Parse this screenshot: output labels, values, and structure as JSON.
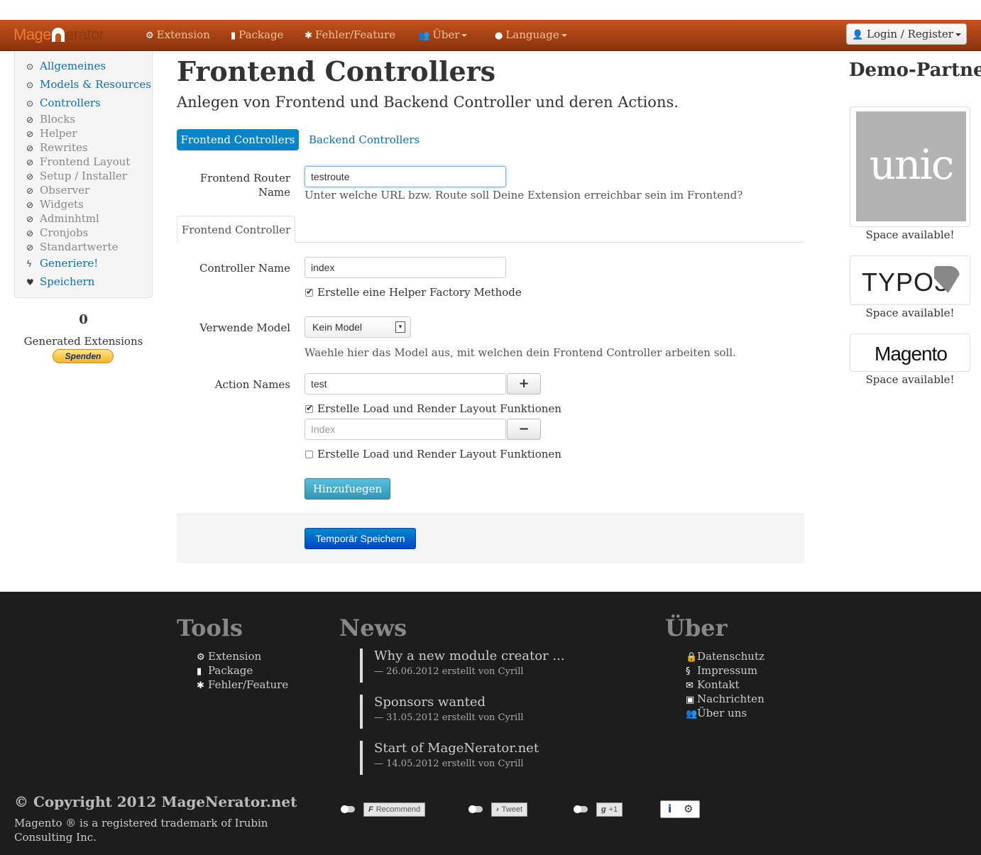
{
  "navbar": {
    "brand_start": "Mage",
    "brand_end": "erator",
    "items": [
      {
        "icon": "gears-icon",
        "glyph": "⚙",
        "label": "Extension"
      },
      {
        "icon": "book-icon",
        "glyph": "▮",
        "label": "Package"
      },
      {
        "icon": "bug-icon",
        "glyph": "✱",
        "label": "Fehler/Feature"
      },
      {
        "icon": "users-icon",
        "glyph": "👥",
        "label": "Über"
      },
      {
        "icon": "globe-icon",
        "glyph": "●",
        "label": "Language"
      }
    ],
    "login_label": "Login / Register"
  },
  "sidebar": {
    "items": [
      {
        "label": "Allgemeines",
        "state": "active",
        "icon": "check-circle-icon"
      },
      {
        "label": "Models & Resources",
        "state": "active",
        "icon": "check-circle-icon"
      },
      {
        "label": "Controllers",
        "state": "active",
        "icon": "check-circle-icon"
      },
      {
        "label": "Blocks",
        "state": "disabled",
        "icon": "ban-icon"
      },
      {
        "label": "Helper",
        "state": "disabled",
        "icon": "ban-icon"
      },
      {
        "label": "Rewrites",
        "state": "disabled",
        "icon": "ban-icon"
      },
      {
        "label": "Frontend Layout",
        "state": "disabled",
        "icon": "ban-icon"
      },
      {
        "label": "Setup / Installer",
        "state": "disabled",
        "icon": "ban-icon"
      },
      {
        "label": "Observer",
        "state": "disabled",
        "icon": "ban-icon"
      },
      {
        "label": "Widgets",
        "state": "disabled",
        "icon": "ban-icon"
      },
      {
        "label": "Adminhtml",
        "state": "disabled",
        "icon": "ban-icon"
      },
      {
        "label": "Cronjobs",
        "state": "disabled",
        "icon": "ban-icon"
      },
      {
        "label": "Standartwerte",
        "state": "disabled",
        "icon": "ban-icon"
      },
      {
        "label": "Generiere!",
        "state": "active",
        "icon": "bolt-icon"
      },
      {
        "label": "Speichern",
        "state": "active",
        "icon": "heart-icon"
      }
    ],
    "generated_count": "0",
    "generated_label": "Generated Extensions",
    "donate_label": "Spenden"
  },
  "main": {
    "title": "Frontend Controllers",
    "subtitle": "Anlegen von Frontend und Backend Controller und deren Actions.",
    "pills": {
      "active": "Frontend Controllers",
      "other": "Backend Controllers"
    },
    "router": {
      "label_line1": "Frontend Router",
      "label_line2": "Name",
      "value": "testroute",
      "help": "Unter welche URL bzw. Route soll Deine Extension erreichbar sein im Frontend?"
    },
    "tab_label": "Frontend Controller",
    "controller": {
      "label": "Controller Name",
      "value": "index",
      "helper_factory_label": "Erstelle eine Helper Factory Methode",
      "helper_factory_checked": true
    },
    "model": {
      "label": "Verwende Model",
      "selected": "Kein Model",
      "help": "Waehle hier das Model aus, mit welchen dein Frontend Controller arbeiten soll."
    },
    "actions": {
      "label": "Action Names",
      "first_value": "test",
      "first_checkbox_label": "Erstelle Load und Render Layout Funktionen",
      "first_checked": true,
      "second_placeholder": "Index",
      "second_checkbox_label": "Erstelle Load und Render Layout Funktionen",
      "second_checked": false,
      "add_symbol": "+",
      "remove_symbol": "−"
    },
    "add_button": "Hinzufuegen",
    "save_button": "Temporär Speichern"
  },
  "partners": {
    "title": "Demo-Partner",
    "logos": [
      "unic",
      "TYPO3",
      "Magento"
    ],
    "space_label": "Space available!"
  },
  "footer": {
    "tools": {
      "heading": "Tools",
      "links": [
        {
          "icon": "gears-icon",
          "glyph": "⚙",
          "label": "Extension"
        },
        {
          "icon": "book-icon",
          "glyph": "▮",
          "label": "Package"
        },
        {
          "icon": "bug-icon",
          "glyph": "✱",
          "label": "Fehler/Feature"
        }
      ]
    },
    "news": {
      "heading": "News",
      "items": [
        {
          "title": "Why a new module creator ...",
          "meta": "— 26.06.2012 erstellt von Cyrill"
        },
        {
          "title": "Sponsors wanted",
          "meta": "— 31.05.2012 erstellt von Cyrill"
        },
        {
          "title": "Start of MageNerator.net",
          "meta": "— 14.05.2012 erstellt von Cyrill"
        }
      ]
    },
    "about": {
      "heading": "Über",
      "links": [
        {
          "icon": "lock-icon",
          "glyph": "🔒",
          "label": "Datenschutz"
        },
        {
          "icon": "paragraph-icon",
          "glyph": "§",
          "label": "Impressum"
        },
        {
          "icon": "envelope-icon",
          "glyph": "✉",
          "label": "Kontakt"
        },
        {
          "icon": "inbox-icon",
          "glyph": "▣",
          "label": "Nachrichten"
        },
        {
          "icon": "users-icon",
          "glyph": "👥",
          "label": "Über uns"
        }
      ]
    },
    "copyright": "© Copyright 2012 MageNerator.net",
    "trademark": "Magento ® is a registered trademark of Irubin Consulting Inc.",
    "social": {
      "facebook_label": "Recommend",
      "twitter_label": "Tweet",
      "google_label": "+1",
      "info_symbol": "i",
      "settings_symbol": "⚙"
    }
  }
}
